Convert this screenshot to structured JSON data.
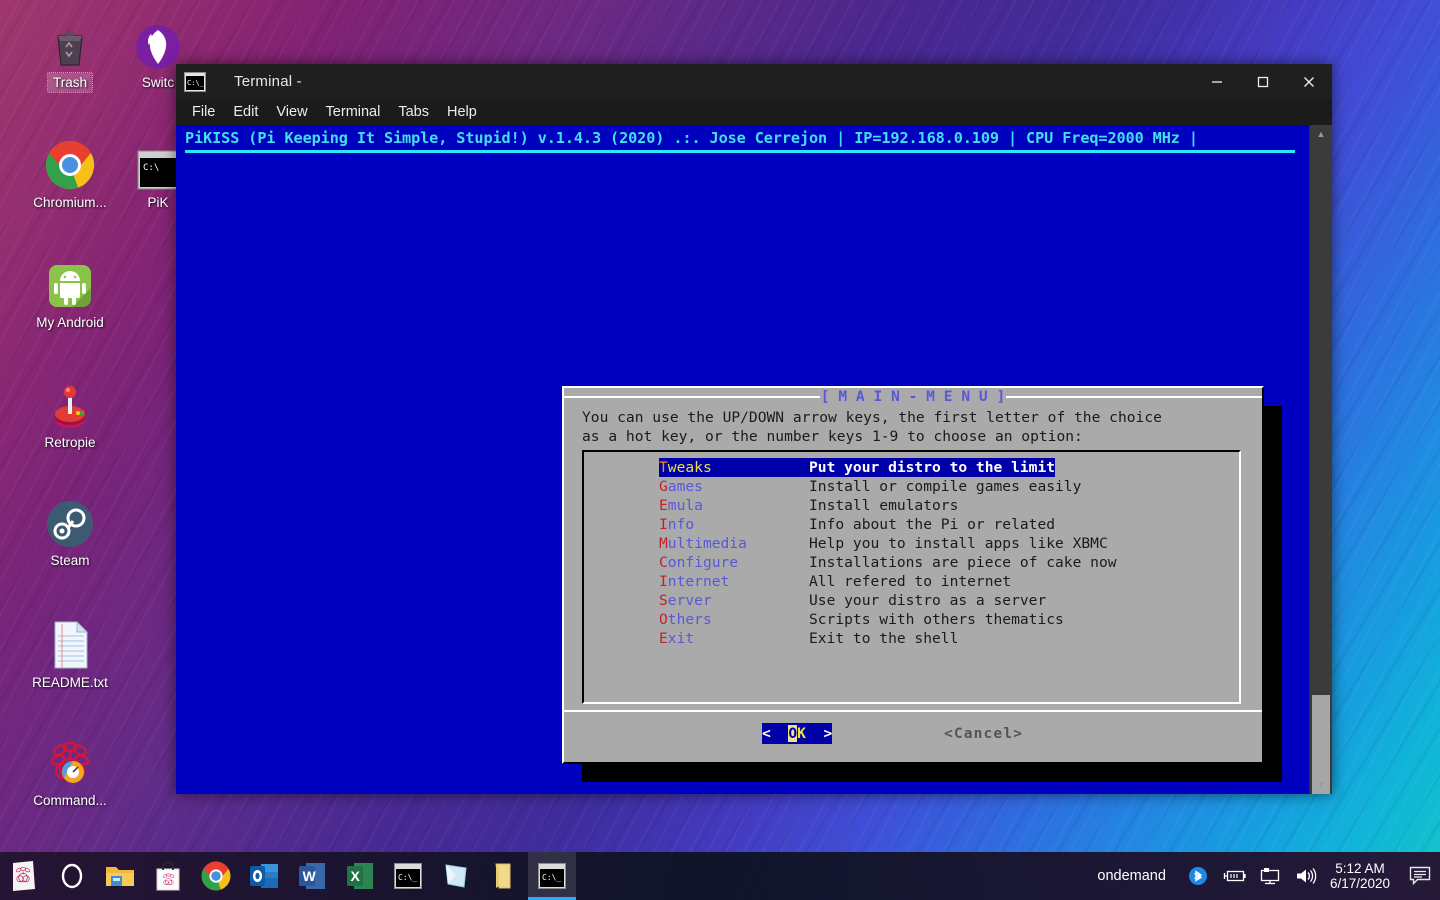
{
  "desktop": {
    "icons": [
      {
        "name": "trash",
        "label": "Trash",
        "selected": true
      },
      {
        "name": "switch",
        "label": "Switc",
        "selected": false
      },
      {
        "name": "chromium",
        "label": "Chromium...",
        "selected": false
      },
      {
        "name": "pikiss",
        "label": "PiK",
        "selected": false
      },
      {
        "name": "my-android",
        "label": "My Android",
        "selected": false
      },
      {
        "name": "retropie",
        "label": "Retropie",
        "selected": false
      },
      {
        "name": "steam",
        "label": "Steam",
        "selected": false
      },
      {
        "name": "readme",
        "label": "README.txt",
        "selected": false
      },
      {
        "name": "command",
        "label": "Command...",
        "selected": false
      }
    ]
  },
  "window": {
    "title": "Terminal -",
    "icon": "terminal-icon",
    "controls": {
      "minimize": "minimize-icon",
      "maximize": "maximize-icon",
      "close": "close-icon"
    },
    "menubar": [
      "File",
      "Edit",
      "View",
      "Terminal",
      "Tabs",
      "Help"
    ]
  },
  "terminal": {
    "header_line": "PiKISS (Pi Keeping It Simple, Stupid!) v.1.4.3 (2020) .:. Jose Cerrejon | IP=192.168.0.109 | CPU Freq=2000 MHz |",
    "background_color": "#0000bf",
    "header_color": "#41e0f0"
  },
  "dialog": {
    "title": "[ M A I N - M E N U ]",
    "prompt_line1": "You can use the UP/DOWN arrow keys, the first letter of the choice",
    "prompt_line2": "as a hot key, or the number keys 1-9 to choose an option:",
    "items": [
      {
        "hot": "T",
        "rest": "weaks",
        "key": "Tweaks",
        "desc": "Put your distro to the limit",
        "selected": true
      },
      {
        "hot": "G",
        "rest": "ames",
        "key": "Games",
        "desc": "Install or compile games easily",
        "selected": false
      },
      {
        "hot": "E",
        "rest": "mula",
        "key": "Emula",
        "desc": "Install emulators",
        "selected": false
      },
      {
        "hot": "I",
        "rest": "nfo",
        "key": "Info",
        "desc": "Info about the Pi or related",
        "selected": false
      },
      {
        "hot": "M",
        "rest": "ultimedia",
        "key": "Multimedia",
        "desc": "Help you to install apps like XBMC",
        "selected": false
      },
      {
        "hot": "C",
        "rest": "onfigure",
        "key": "Configure",
        "desc": "Installations are piece of cake now",
        "selected": false
      },
      {
        "hot": "I",
        "rest": "nternet",
        "key": "Internet",
        "desc": "All refered to internet",
        "selected": false
      },
      {
        "hot": "S",
        "rest": "erver",
        "key": "Server",
        "desc": "Use your distro as a server",
        "selected": false
      },
      {
        "hot": "O",
        "rest": "thers",
        "key": "Others",
        "desc": "Scripts with others thematics",
        "selected": false
      },
      {
        "hot": "E",
        "rest": "xit",
        "key": "Exit",
        "desc": "Exit to the shell",
        "selected": false
      }
    ],
    "ok_button": {
      "left": "<  ",
      "o": "O",
      "k": "K",
      "right": "  >",
      "label": "< OK >"
    },
    "cancel_button": "<Cancel>"
  },
  "taskbar": {
    "items": [
      {
        "name": "start-raspberry-icon",
        "active": false
      },
      {
        "name": "cortana-icon",
        "active": false
      },
      {
        "name": "file-explorer-icon",
        "active": false
      },
      {
        "name": "pi-store-icon",
        "active": false
      },
      {
        "name": "chrome-icon",
        "active": false
      },
      {
        "name": "outlook-icon",
        "active": false
      },
      {
        "name": "word-icon",
        "active": false
      },
      {
        "name": "excel-icon",
        "active": false
      },
      {
        "name": "terminal-icon",
        "active": false
      },
      {
        "name": "sticky-notes-icon",
        "active": false
      },
      {
        "name": "folder-icon",
        "active": false
      },
      {
        "name": "terminal-active-icon",
        "active": true
      }
    ],
    "tray_label": "ondemand",
    "tray_icons": [
      "bluetooth-icon",
      "battery-icon",
      "network-icon",
      "volume-icon"
    ],
    "clock_time": "5:12 AM",
    "clock_date": "6/17/2020",
    "action_center": "action-center-icon"
  }
}
